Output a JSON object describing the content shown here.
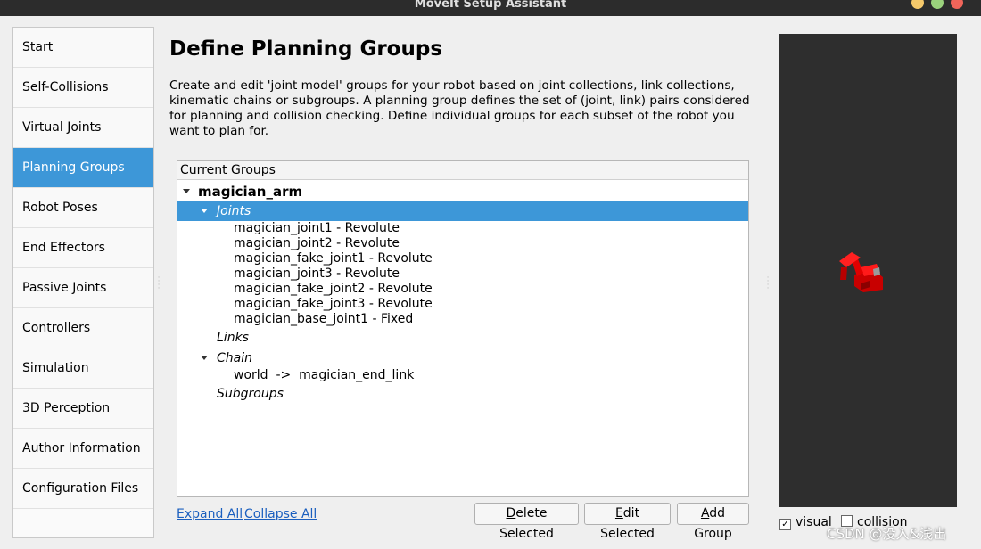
{
  "window": {
    "title": "MoveIt Setup Assistant"
  },
  "sidebar": {
    "items": [
      {
        "label": "Start"
      },
      {
        "label": "Self-Collisions"
      },
      {
        "label": "Virtual Joints"
      },
      {
        "label": "Planning Groups",
        "active": true
      },
      {
        "label": "Robot Poses"
      },
      {
        "label": "End Effectors"
      },
      {
        "label": "Passive Joints"
      },
      {
        "label": "Controllers"
      },
      {
        "label": "Simulation"
      },
      {
        "label": "3D Perception"
      },
      {
        "label": "Author Information"
      },
      {
        "label": "Configuration Files"
      }
    ]
  },
  "main": {
    "title": "Define Planning Groups",
    "description": "Create and edit 'joint model' groups for your robot based on joint collections, link collections, kinematic chains or subgroups. A planning group defines the set of (joint, link) pairs considered for planning and collision checking. Define individual groups for each subset of the robot you want to plan for.",
    "tree": {
      "header": "Current Groups",
      "group": "magician_arm",
      "joints_label": "Joints",
      "joints": [
        "magician_joint1 - Revolute",
        "magician_joint2 - Revolute",
        "magician_fake_joint1 - Revolute",
        "magician_joint3 - Revolute",
        "magician_fake_joint2 - Revolute",
        "magician_fake_joint3 - Revolute",
        "magician_base_joint1 - Fixed"
      ],
      "links_label": "Links",
      "chain_label": "Chain",
      "chain_value": "world  ->  magician_end_link",
      "subgroups_label": "Subgroups"
    },
    "expand_all": "Expand All",
    "collapse_all": "Collapse All",
    "buttons": {
      "delete_first": "D",
      "delete_rest": "elete Selected",
      "edit_first": "E",
      "edit_rest": "dit Selected",
      "add_first": "A",
      "add_rest": "dd Group"
    }
  },
  "viewer": {
    "visual_label": "visual",
    "visual_checked": true,
    "collision_label": "collision",
    "collision_checked": false,
    "robot_color": "#e00000"
  },
  "watermark": "CSDN @没入&浅出"
}
